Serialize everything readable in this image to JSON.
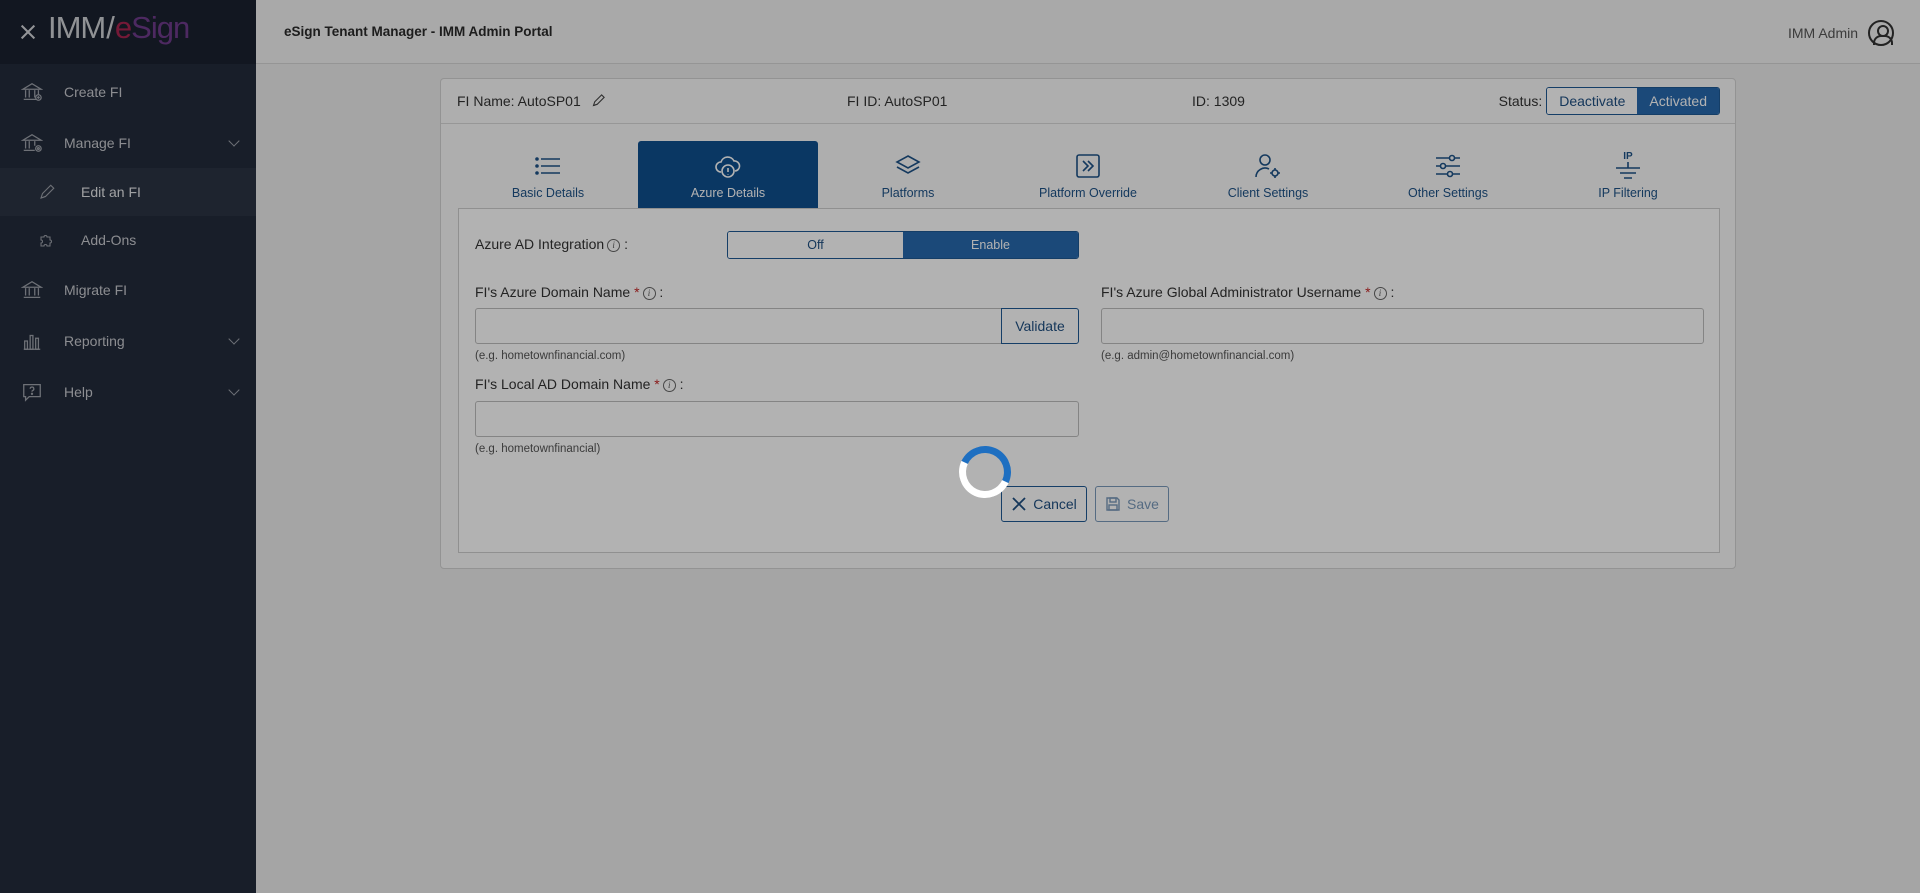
{
  "app": {
    "logo_left": "IMM",
    "logo_slash": "/",
    "logo_e": "e",
    "logo_right": "Sign",
    "title": "eSign Tenant Manager - IMM Admin Portal",
    "user": "IMM Admin"
  },
  "sidebar": {
    "items": [
      {
        "label": "Create FI",
        "icon": "bank-icon"
      },
      {
        "label": "Manage FI",
        "icon": "bank-gear-icon"
      },
      {
        "label": "Edit an FI",
        "icon": "pencil-icon"
      },
      {
        "label": "Add-Ons",
        "icon": "puzzle-icon"
      },
      {
        "label": "Migrate FI",
        "icon": "bank-arrow-icon"
      },
      {
        "label": "Reporting",
        "icon": "bar-chart-icon"
      },
      {
        "label": "Help",
        "icon": "help-bubble-icon"
      }
    ]
  },
  "fi_header": {
    "name_label": "FI Name: AutoSP01",
    "fi_id_label": "FI ID: AutoSP01",
    "id_label": "ID: 1309",
    "status_label": "Status:",
    "deactivate": "Deactivate",
    "activated": "Activated"
  },
  "tabs": [
    {
      "label": "Basic Details",
      "icon": "list-icon",
      "active": false
    },
    {
      "label": "Azure Details",
      "icon": "cloud-icon",
      "active": true
    },
    {
      "label": "Platforms",
      "icon": "layers-icon",
      "active": false
    },
    {
      "label": "Platform Override",
      "icon": "override-icon",
      "active": false
    },
    {
      "label": "Client Settings",
      "icon": "user-gear-icon",
      "active": false
    },
    {
      "label": "Other Settings",
      "icon": "sliders-icon",
      "active": false
    },
    {
      "label": "IP Filtering",
      "icon": "ip-filter-icon",
      "active": false
    }
  ],
  "ip_icon_text": "IP",
  "form": {
    "azure_ad_label": "Azure AD Integration",
    "toggle_off": "Off",
    "toggle_enable": "Enable",
    "azure_domain_label": "FI's Azure Domain Name",
    "azure_domain_value": "",
    "azure_domain_hint": "(e.g. hometownfinancial.com)",
    "validate": "Validate",
    "admin_username_label": "FI's Azure Global Administrator Username",
    "admin_username_value": "",
    "admin_username_hint": "(e.g. admin@hometownfinancial.com)",
    "local_domain_label": "FI's Local AD Domain Name",
    "local_domain_value": "",
    "local_domain_hint": "(e.g. hometownfinancial)",
    "required_mark": "*",
    "colon": ":",
    "info_glyph": "i",
    "cancel": "Cancel",
    "save": "Save"
  },
  "colors": {
    "sidebar_bg": "#232b3b",
    "accent": "#0f4f8f",
    "button_blue": "#2869ae",
    "required": "#c62828",
    "spinner": "#1e6fc1"
  }
}
